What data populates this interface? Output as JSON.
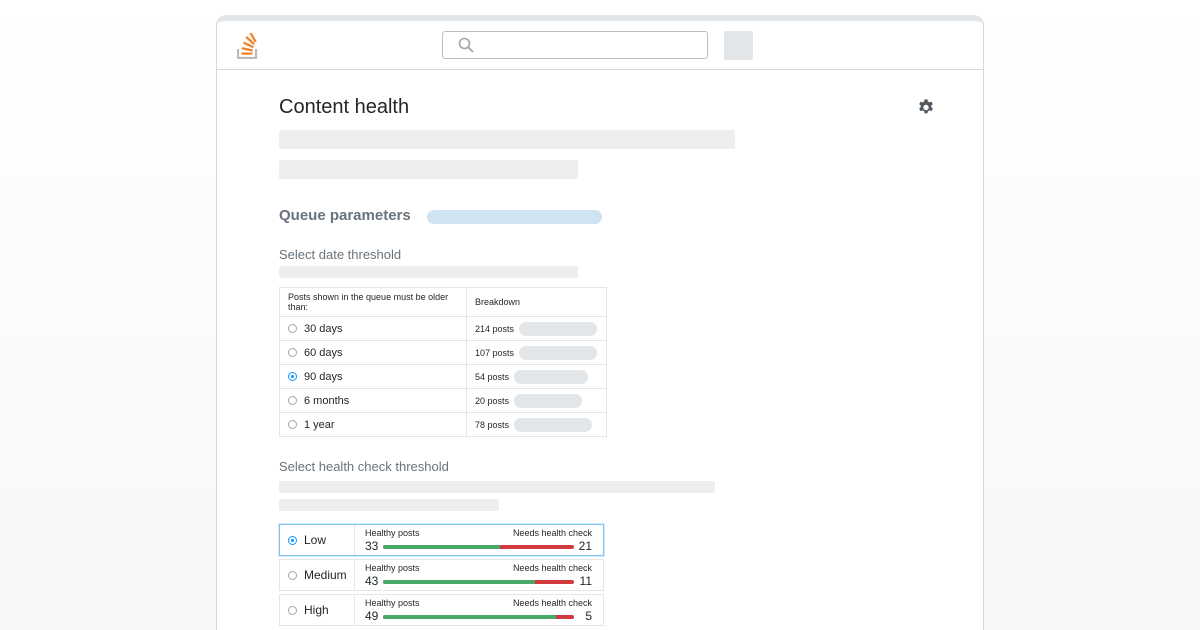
{
  "page": {
    "title": "Content health",
    "section_title": "Queue parameters"
  },
  "date_threshold": {
    "heading": "Select date threshold",
    "col_header_1": "Posts shown in the queue must be older than:",
    "col_header_2": "Breakdown",
    "rows": [
      {
        "label": "30 days",
        "posts": "214 posts",
        "selected": false
      },
      {
        "label": "60 days",
        "posts": "107 posts",
        "selected": false
      },
      {
        "label": "90 days",
        "posts": "54 posts",
        "selected": true
      },
      {
        "label": "6 months",
        "posts": "20 posts",
        "selected": false
      },
      {
        "label": "1 year",
        "posts": "78 posts",
        "selected": false
      }
    ]
  },
  "health_threshold": {
    "heading": "Select health check threshold",
    "left_label": "Healthy posts",
    "right_label": "Needs health check",
    "rows": [
      {
        "label": "Low",
        "healthy": "33",
        "needs": "21",
        "selected": true
      },
      {
        "label": "Medium",
        "healthy": "43",
        "needs": "11",
        "selected": false
      },
      {
        "label": "High",
        "healthy": "49",
        "needs": "5",
        "selected": false
      }
    ]
  },
  "icons": {
    "logo": "stack-overflow-logo",
    "search": "search-icon",
    "settings": "gear-icon"
  },
  "colors": {
    "accent": "#0a95ff",
    "logo_orange": "#f48024",
    "healthy": "#48a868",
    "needs_check": "#d0393e"
  }
}
